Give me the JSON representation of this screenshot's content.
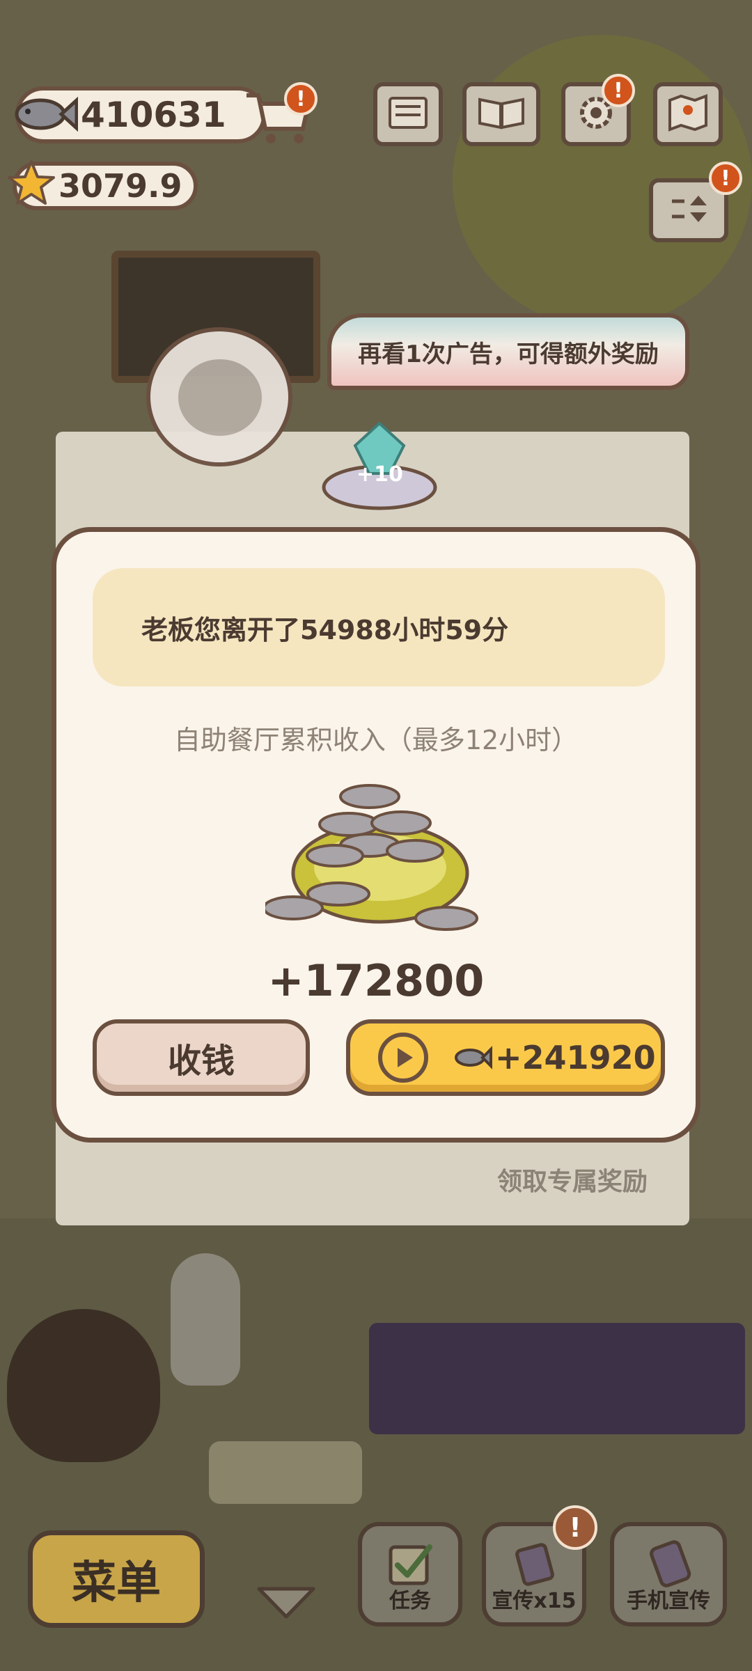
{
  "hud": {
    "fish_amount": "410631",
    "star_amount": "3079.9"
  },
  "ribbon": {
    "text": "再看1次广告，可得额外奖励"
  },
  "gem_bonus": "+10",
  "modal": {
    "away_message": "老板您离开了54988小时59分",
    "subtitle": "自助餐厅累积收入（最多12小时）",
    "income": "+172800",
    "collect_label": "收钱",
    "ad_reward": "+241920"
  },
  "background": {
    "paper_footer": "领取专属奖励"
  },
  "bottom_bar": {
    "menu_label": "菜单",
    "task_label": "任务",
    "promo_label": "宣传x15",
    "phone_promo_label": "手机宣传"
  },
  "colors": {
    "accent_yellow": "#fbc94a",
    "alert_orange": "#d1541c",
    "outline_brown": "#6b5040",
    "modal_bg": "#fbf4ea"
  }
}
